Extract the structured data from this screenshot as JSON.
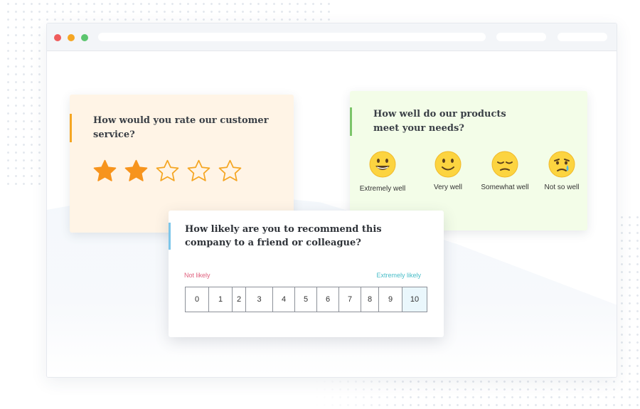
{
  "colors": {
    "accent_orange": "#f5a623",
    "accent_green": "#7cc56a",
    "accent_blue": "#7dc6ea",
    "low_label": "#e0607e",
    "high_label": "#49bdc8",
    "traffic_red": "#ef5c5c",
    "traffic_yellow": "#f5a623",
    "traffic_green": "#5bc56e"
  },
  "rating_card": {
    "question": "How would you rate our customer service?",
    "rating": 2,
    "max": 5,
    "star_icon": "star-icon"
  },
  "emoji_card": {
    "question": "How well do our products meet your needs?",
    "options": [
      {
        "label": "Extremely well",
        "icon": "grinning-face-icon"
      },
      {
        "label": "Very well",
        "icon": "smiling-face-icon"
      },
      {
        "label": "Somewhat well",
        "icon": "pensive-face-icon"
      },
      {
        "label": "Not so well",
        "icon": "crying-face-icon"
      }
    ]
  },
  "nps_card": {
    "question": "How likely are you to recommend this company to a friend or colleague?",
    "low_label": "Not likely",
    "high_label": "Extremely likely",
    "scale": [
      "0",
      "1",
      "2",
      "3",
      "4",
      "5",
      "6",
      "7",
      "8",
      "9",
      "10"
    ],
    "selected": "10"
  }
}
